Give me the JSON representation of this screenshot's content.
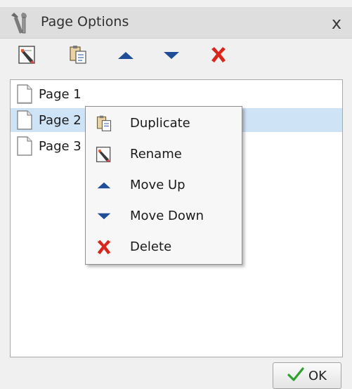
{
  "dialog": {
    "title": "Page Options",
    "close_label": "x"
  },
  "toolbar": {
    "buttons": [
      {
        "name": "rename",
        "icon": "rename-icon"
      },
      {
        "name": "duplicate",
        "icon": "duplicate-icon"
      },
      {
        "name": "move-up",
        "icon": "arrow-up-icon"
      },
      {
        "name": "move-down",
        "icon": "arrow-down-icon"
      },
      {
        "name": "delete",
        "icon": "delete-x-icon"
      }
    ]
  },
  "pages": [
    {
      "label": "Page 1",
      "selected": false
    },
    {
      "label": "Page 2",
      "selected": true
    },
    {
      "label": "Page 3",
      "selected": false
    }
  ],
  "context_menu": {
    "items": [
      {
        "label": "Duplicate",
        "icon": "duplicate-icon"
      },
      {
        "label": "Rename",
        "icon": "rename-icon"
      },
      {
        "label": "Move Up",
        "icon": "arrow-up-icon"
      },
      {
        "label": "Move Down",
        "icon": "arrow-down-icon"
      },
      {
        "label": "Delete",
        "icon": "delete-x-icon"
      }
    ]
  },
  "footer": {
    "ok_label": "OK"
  },
  "colors": {
    "accent_blue": "#1f4e99",
    "delete_red": "#d9261c",
    "ok_green": "#2fa12f",
    "selection": "#cfe3f7"
  }
}
